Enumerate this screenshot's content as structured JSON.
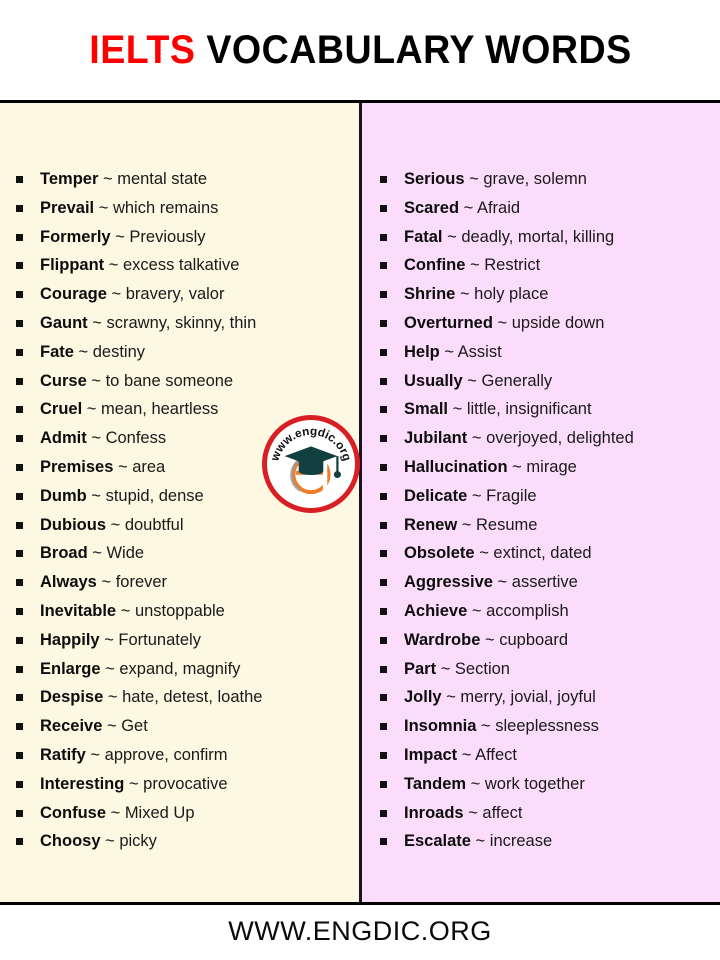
{
  "header": {
    "title_accent": "IELTS",
    "title_rest": " VOCABULARY WORDS"
  },
  "separator": "~",
  "left_column": {
    "background_color": "#FDF8E1",
    "items": [
      {
        "term": "Temper",
        "definition": "mental state"
      },
      {
        "term": "Prevail",
        "definition": "which remains"
      },
      {
        "term": "Formerly",
        "definition": "Previously"
      },
      {
        "term": "Flippant",
        "definition": "excess talkative"
      },
      {
        "term": "Courage",
        "definition": "bravery, valor"
      },
      {
        "term": "Gaunt",
        "definition": "scrawny, skinny, thin"
      },
      {
        "term": "Fate",
        "definition": "destiny"
      },
      {
        "term": "Curse",
        "definition": "to bane someone"
      },
      {
        "term": "Cruel",
        "definition": "mean, heartless"
      },
      {
        "term": "Admit",
        "definition": "Confess"
      },
      {
        "term": "Premises",
        "definition": "area"
      },
      {
        "term": "Dumb",
        "definition": "stupid, dense"
      },
      {
        "term": "Dubious",
        "definition": "doubtful"
      },
      {
        "term": "Broad",
        "definition": "Wide"
      },
      {
        "term": "Always",
        "definition": "forever"
      },
      {
        "term": "Inevitable",
        "definition": "unstoppable"
      },
      {
        "term": "Happily",
        "definition": "Fortunately"
      },
      {
        "term": "Enlarge",
        "definition": "expand, magnify"
      },
      {
        "term": "Despise",
        "definition": "hate, detest, loathe"
      },
      {
        "term": "Receive",
        "definition": "Get"
      },
      {
        "term": "Ratify",
        "definition": "approve, confirm"
      },
      {
        "term": "Interesting",
        "definition": "provocative"
      },
      {
        "term": "Confuse",
        "definition": "Mixed Up"
      },
      {
        "term": "Choosy",
        "definition": "picky"
      }
    ]
  },
  "right_column": {
    "background_color": "#FBDDFB",
    "items": [
      {
        "term": "Serious",
        "definition": "grave, solemn"
      },
      {
        "term": "Scared",
        "definition": "Afraid"
      },
      {
        "term": "Fatal",
        "definition": "deadly, mortal, killing"
      },
      {
        "term": "Confine",
        "definition": "Restrict"
      },
      {
        "term": "Shrine",
        "definition": "holy place"
      },
      {
        "term": "Overturned",
        "definition": "upside down"
      },
      {
        "term": "Help",
        "definition": "Assist"
      },
      {
        "term": "Usually",
        "definition": "Generally"
      },
      {
        "term": "Small",
        "definition": "little, insignificant"
      },
      {
        "term": "Jubilant",
        "definition": "overjoyed, delighted"
      },
      {
        "term": "Hallucination",
        "definition": "mirage"
      },
      {
        "term": "Delicate",
        "definition": "Fragile"
      },
      {
        "term": "Renew",
        "definition": "Resume"
      },
      {
        "term": "Obsolete",
        "definition": "extinct, dated"
      },
      {
        "term": "Aggressive",
        "definition": "assertive"
      },
      {
        "term": "Achieve",
        "definition": "accomplish"
      },
      {
        "term": "Wardrobe",
        "definition": "cupboard"
      },
      {
        "term": "Part",
        "definition": "Section"
      },
      {
        "term": "Jolly",
        "definition": "merry, jovial, joyful"
      },
      {
        "term": "Insomnia",
        "definition": "sleeplessness"
      },
      {
        "term": "Impact",
        "definition": "Affect"
      },
      {
        "term": "Tandem",
        "definition": "work together"
      },
      {
        "term": "Inroads",
        "definition": "affect"
      },
      {
        "term": "Escalate",
        "definition": "increase"
      }
    ]
  },
  "logo": {
    "text": "www.engdic.org",
    "ring_color": "#D81F26",
    "cap_color": "#123F3F",
    "letter_color": "#F07B28"
  },
  "footer": {
    "text": "WWW.ENGDIC.ORG"
  }
}
